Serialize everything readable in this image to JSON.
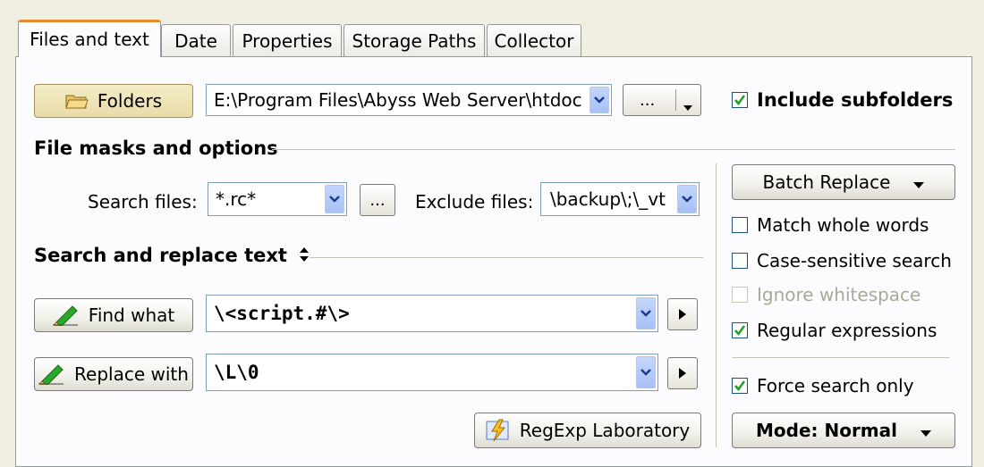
{
  "tabs": [
    {
      "label": "Files and text",
      "active": true
    },
    {
      "label": "Date",
      "active": false
    },
    {
      "label": "Properties",
      "active": false
    },
    {
      "label": "Storage Paths",
      "active": false
    },
    {
      "label": "Collector",
      "active": false
    }
  ],
  "folders": {
    "button_label": "Folders",
    "path_value": "E:\\Program Files\\Abyss Web Server\\htdoc",
    "browse_label": "...",
    "include_subfolders_label": "Include subfolders",
    "include_subfolders_checked": true
  },
  "file_masks": {
    "section_title": "File masks and options",
    "search_files_label": "Search files:",
    "search_files_value": "*.rc*",
    "browse_label": "...",
    "exclude_files_label": "Exclude files:",
    "exclude_files_value": "\\backup\\;\\_vt"
  },
  "search_replace": {
    "section_title": "Search and replace text",
    "sort_icon": "updown-arrows-icon",
    "find_label": "Find what",
    "find_value": "\\<script.#\\>",
    "replace_label": "Replace with",
    "replace_value": "\\L\\0",
    "regexp_lab_label": "RegExp Laboratory"
  },
  "options": {
    "batch_replace_label": "Batch Replace",
    "match_whole_words": {
      "label": "Match whole words",
      "checked": false
    },
    "case_sensitive": {
      "label": "Case-sensitive search",
      "checked": false
    },
    "ignore_whitespace": {
      "label": "Ignore whitespace",
      "checked": false,
      "disabled": true
    },
    "regular_expressions": {
      "label": "Regular expressions",
      "checked": true
    },
    "force_search_only": {
      "label": "Force search only",
      "checked": true
    },
    "mode_label": "Mode: Normal"
  },
  "colors": {
    "accent_tab": "#e68b2c",
    "combo_border": "#7f9db9",
    "dropdown_blue": "#a7c0f5",
    "pressed_button": "#efe3b6"
  }
}
